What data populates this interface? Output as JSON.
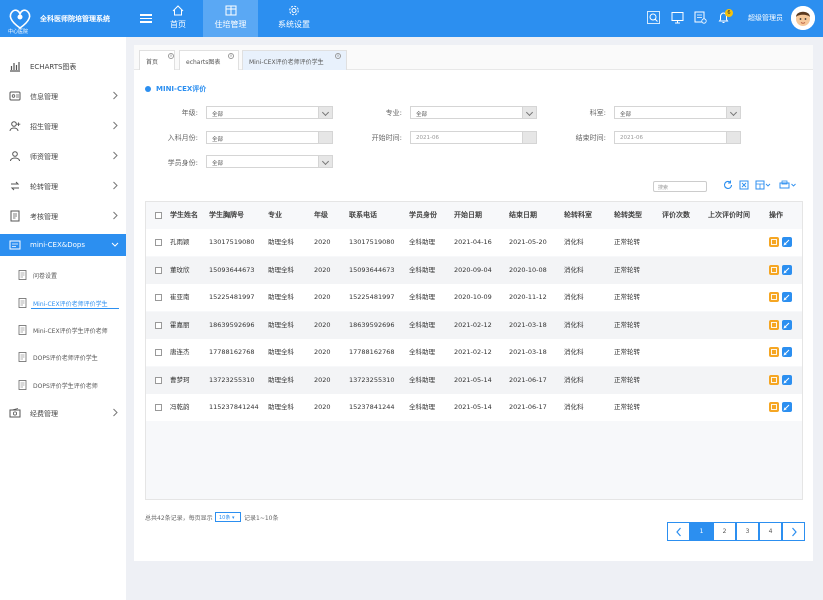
{
  "header": {
    "system_title": "全科医师院培管理系统",
    "system_subtitle": "中心医院",
    "nav": [
      {
        "label": "首页",
        "icon": "home-icon"
      },
      {
        "label": "住培管理",
        "icon": "document-grid-icon"
      },
      {
        "label": "系统设置",
        "icon": "gear-icon"
      }
    ],
    "notification_count": "6",
    "user_name": "超级管理员"
  },
  "sidebar": {
    "items": [
      {
        "label": "ECHARTS图表",
        "icon": "chart-icon"
      },
      {
        "label": "信息管理",
        "icon": "info-icon"
      },
      {
        "label": "招生管理",
        "icon": "person-add-icon"
      },
      {
        "label": "师资管理",
        "icon": "teacher-icon"
      },
      {
        "label": "轮转管理",
        "icon": "rotate-icon"
      },
      {
        "label": "考核管理",
        "icon": "exam-icon"
      },
      {
        "label": "mini-CEX&Dops",
        "icon": "assessment-icon"
      },
      {
        "label": "经费管理",
        "icon": "money-icon"
      }
    ],
    "subitems": [
      {
        "label": "问卷设置"
      },
      {
        "label": "Mini-CEX评价老师评价学生"
      },
      {
        "label": "Mini-CEX评价学生评价老师"
      },
      {
        "label": "DOPS评价老师评价学生"
      },
      {
        "label": "DOPS评价学生评价老师"
      }
    ]
  },
  "tabs": [
    {
      "label": "首页"
    },
    {
      "label": "echarts图表"
    },
    {
      "label": "Mini-CEX评价老师评价学生"
    }
  ],
  "section_title": "MINI-CEX评价",
  "filters": {
    "grade_label": "年级:",
    "grade_value": "全部",
    "major_label": "专业:",
    "major_value": "全部",
    "dept_label": "科室:",
    "dept_value": "全部",
    "enroll_label": "入科月份:",
    "enroll_value": "全部",
    "start_label": "开始时间:",
    "start_value": "2021-06",
    "end_label": "结束时间:",
    "end_value": "2021-06",
    "identity_label": "学员身份:",
    "identity_value": "全部"
  },
  "search_placeholder": "搜索",
  "table": {
    "headers": [
      "学生姓名",
      "学生胸牌号",
      "专业",
      "年级",
      "联系电话",
      "学员身份",
      "开始日期",
      "结束日期",
      "轮转科室",
      "轮转类型",
      "评价次数",
      "上次评价时间",
      "操作"
    ],
    "rows": [
      [
        "孔雨颖",
        "13017519080",
        "助理全科",
        "2020",
        "13017519080",
        "全科助理",
        "2021-04-16",
        "2021-05-20",
        "消化科",
        "正常轮转",
        "",
        ""
      ],
      [
        "董玟欣",
        "15093644673",
        "助理全科",
        "2020",
        "15093644673",
        "全科助理",
        "2020-09-04",
        "2020-10-08",
        "消化科",
        "正常轮转",
        "",
        ""
      ],
      [
        "崔亚南",
        "15225481997",
        "助理全科",
        "2020",
        "15225481997",
        "全科助理",
        "2020-10-09",
        "2020-11-12",
        "消化科",
        "正常轮转",
        "",
        ""
      ],
      [
        "霍嘉丽",
        "18639592696",
        "助理全科",
        "2020",
        "18639592696",
        "全科助理",
        "2021-02-12",
        "2021-03-18",
        "消化科",
        "正常轮转",
        "",
        ""
      ],
      [
        "唐连杰",
        "17788162768",
        "助理全科",
        "2020",
        "17788162768",
        "全科助理",
        "2021-02-12",
        "2021-03-18",
        "消化科",
        "正常轮转",
        "",
        ""
      ],
      [
        "曹梦珂",
        "13723255310",
        "助理全科",
        "2020",
        "13723255310",
        "全科助理",
        "2021-05-14",
        "2021-06-17",
        "消化科",
        "正常轮转",
        "",
        ""
      ],
      [
        "冯乾韵",
        "115237841244",
        "助理全科",
        "2020",
        "15237841244",
        "全科助理",
        "2021-05-14",
        "2021-06-17",
        "消化科",
        "正常轮转",
        "",
        ""
      ]
    ]
  },
  "footer": {
    "total_text": "总共42条记录，每页显示",
    "page_size": "10条",
    "range_text": "记录1~10条",
    "pages": [
      "1",
      "2",
      "3",
      "4"
    ]
  },
  "colors": {
    "primary": "#2c8ff0",
    "edit": "#f5a623",
    "view": "#2c8ff0"
  }
}
